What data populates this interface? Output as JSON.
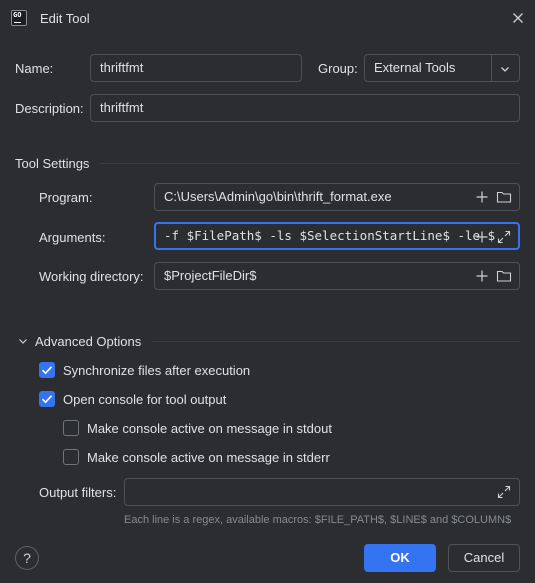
{
  "window": {
    "title": "Edit Tool",
    "app_icon_text": "GO"
  },
  "form": {
    "name_label": "Name:",
    "name_value": "thriftfmt",
    "group_label": "Group:",
    "group_value": "External Tools",
    "description_label": "Description:",
    "description_value": "thriftfmt"
  },
  "tool_settings": {
    "section_title": "Tool Settings",
    "program_label": "Program:",
    "program_value": "C:\\Users\\Admin\\go\\bin\\thrift_format.exe",
    "arguments_label": "Arguments:",
    "arguments_value": "-f $FilePath$ -ls $SelectionStartLine$ -le $",
    "working_dir_label": "Working directory:",
    "working_dir_value": "$ProjectFileDir$"
  },
  "advanced": {
    "section_title": "Advanced Options",
    "sync_files_label": "Synchronize files after execution",
    "sync_files_checked": true,
    "open_console_label": "Open console for tool output",
    "open_console_checked": true,
    "console_stdout_label": "Make console active on message in stdout",
    "console_stdout_checked": false,
    "console_stderr_label": "Make console active on message in stderr",
    "console_stderr_checked": false,
    "output_filters_label": "Output filters:",
    "output_filters_value": "",
    "output_filters_hint": "Each line is a regex, available macros: $FILE_PATH$, $LINE$ and $COLUMN$"
  },
  "footer": {
    "help_label": "?",
    "ok_label": "OK",
    "cancel_label": "Cancel"
  },
  "colors": {
    "background": "#2b2d30",
    "accent": "#3574f0",
    "border": "#4e5157",
    "text": "#dfe1e5",
    "hint": "#868a91"
  }
}
